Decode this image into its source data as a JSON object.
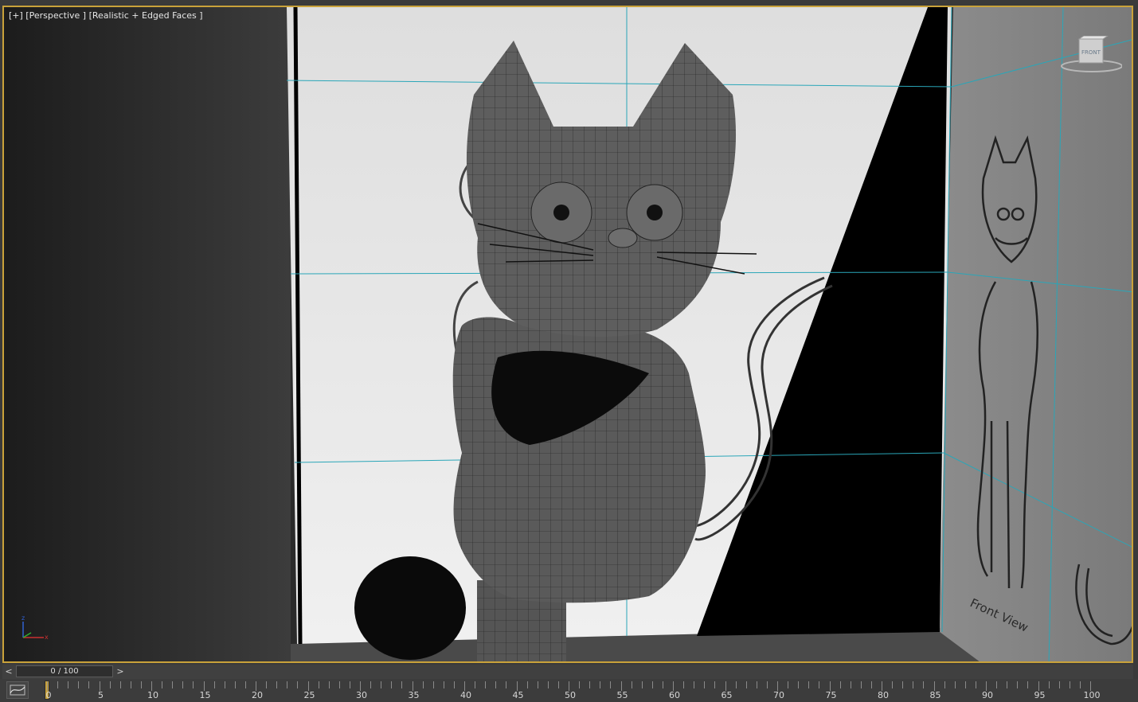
{
  "viewport": {
    "label": "[+] [Perspective ] [Realistic + Edged Faces ]",
    "viewcube_face": "FRONT",
    "reference_caption": "Front View",
    "gizmo_axes": {
      "z": "z",
      "x": "x"
    },
    "colors": {
      "active_border": "#c9a23a",
      "grid_line": "#2aa6b8",
      "axis_x": "#c83030",
      "axis_y": "#30b030",
      "axis_z": "#3060d0"
    }
  },
  "timeline": {
    "prev_label": "<",
    "next_label": ">",
    "slider_text": "0 / 100",
    "current_frame": 0,
    "total_frames": 100,
    "tick_labels": [
      "0",
      "5",
      "10",
      "15",
      "20",
      "25",
      "30",
      "35",
      "40",
      "45",
      "50",
      "55",
      "60",
      "65",
      "70",
      "75",
      "80",
      "85",
      "90",
      "95",
      "100"
    ]
  },
  "icons": {
    "curve_editor": "curve-editor-icon",
    "frame_marker": "current-frame-marker"
  }
}
